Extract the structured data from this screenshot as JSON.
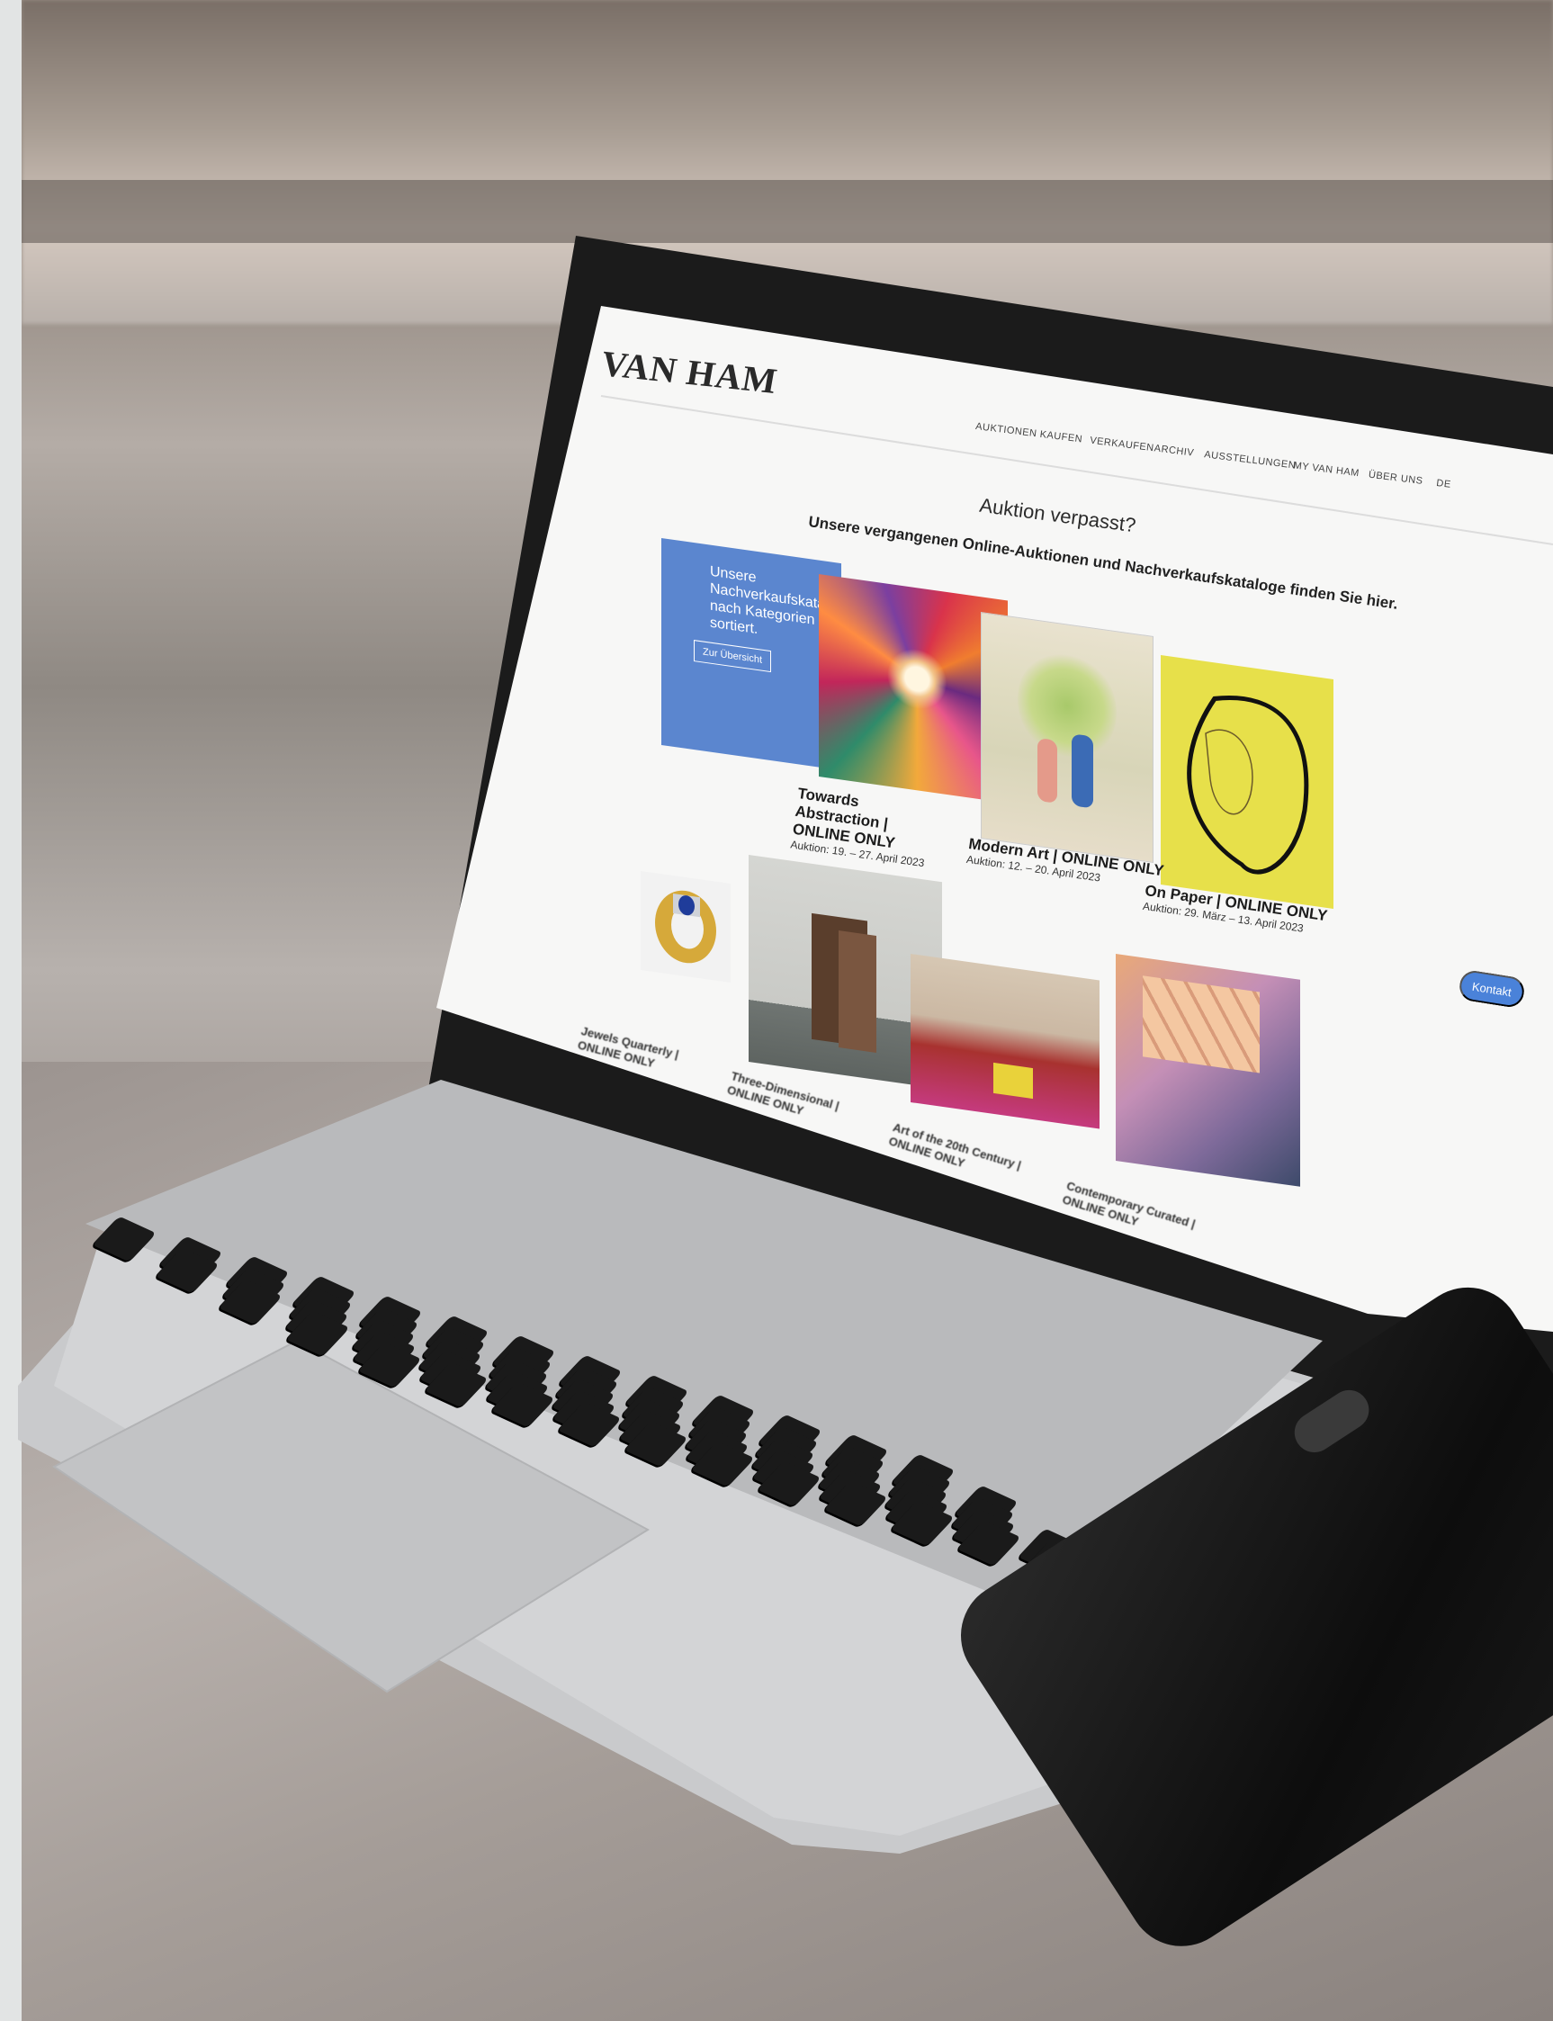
{
  "site": {
    "logo": "VAN HAM",
    "nav": [
      "AUKTIONEN",
      "KAUFEN",
      "VERKAUFEN",
      "ARCHIV",
      "AUSSTELLUNGEN",
      "MY VAN HAM",
      "ÜBER UNS",
      "DE"
    ]
  },
  "content": {
    "headline": "Auktion verpasst?",
    "subline": "Unsere vergangenen Online-Auktionen und Nachverkaufskataloge finden Sie hier.",
    "promo": {
      "text": "Unsere Nachverkaufskataloge nach Kategorien sortiert.",
      "button": "Zur Übersicht"
    },
    "auctions": [
      {
        "title": "Towards Abstraction | ONLINE ONLY",
        "date": "Auktion: 19. – 27. April 2023"
      },
      {
        "title": "Modern Art | ONLINE ONLY",
        "date": "Auktion: 12. – 20. April 2023"
      },
      {
        "title": "On Paper | ONLINE ONLY",
        "date": "Auktion: 29. März – 13. April 2023"
      },
      {
        "title": "Jewels Quarterly | ONLINE ONLY",
        "date": ""
      },
      {
        "title": "Three-Dimensional | ONLINE ONLY",
        "date": ""
      },
      {
        "title": "Art of the 20th Century | ONLINE ONLY",
        "date": ""
      },
      {
        "title": "Contemporary Curated | ONLINE ONLY",
        "date": ""
      }
    ],
    "kontakt_button": "Kontakt"
  },
  "colors": {
    "promo_blue": "#5b86cf",
    "kontakt_blue": "#4a82d9"
  }
}
